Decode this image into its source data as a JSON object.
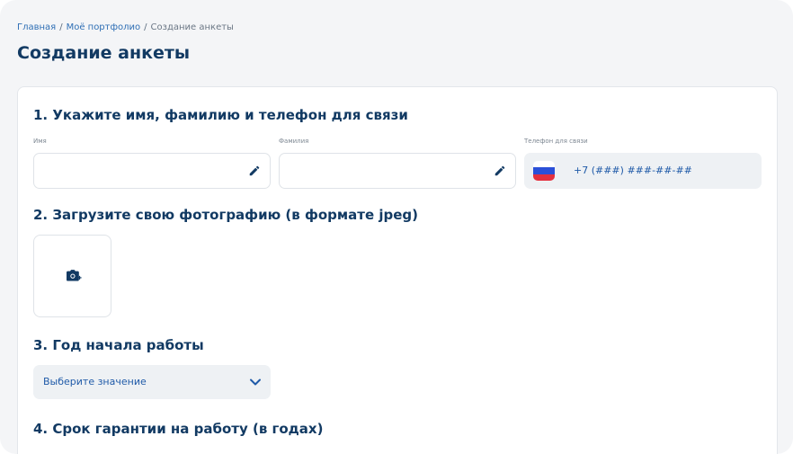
{
  "breadcrumb": {
    "home": "Главная",
    "portfolio": "Моё портфолио",
    "current": "Создание анкеты",
    "separator": "/"
  },
  "page_title": "Создание анкеты",
  "sections": {
    "contacts": {
      "title": "1. Укажите имя, фамилию и телефон для связи",
      "first_name_label": "Имя",
      "last_name_label": "Фамилия",
      "phone_label": "Телефон для связи",
      "phone_placeholder": "+7 (###) ###-##-##",
      "first_name_value": "",
      "last_name_value": ""
    },
    "photo": {
      "title": "2. Загрузите свою фотографию (в формате jpeg)"
    },
    "start_year": {
      "title": "3. Год начала работы",
      "select_value": "Выберите значение"
    },
    "warranty": {
      "title": "4. Срок гарантии на работу (в годах)"
    }
  },
  "icons": {
    "edit": "pencil-icon",
    "flag": "russia-flag-icon",
    "camera": "camera-add-icon",
    "dropdown": "chevron-down-icon"
  },
  "colors": {
    "primary_text": "#123a63",
    "link": "#2f6fb5",
    "field_bg": "#eef1f4"
  }
}
